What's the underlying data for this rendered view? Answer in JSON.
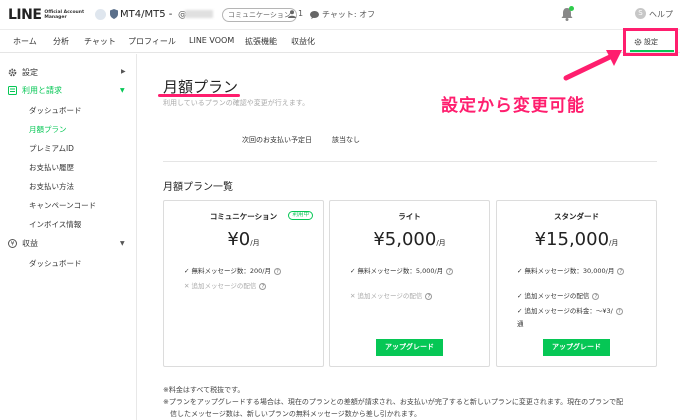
{
  "header": {
    "logo_main": "LINE",
    "logo_sub": "Official Account Manager",
    "account_name": "MT4/MT5 -",
    "account_id_prefix": "@",
    "plan_badge": "コミュニケーション",
    "friends": "1",
    "chat_status": "チャット: オフ",
    "help": "ヘルプ"
  },
  "nav": {
    "items": [
      "ホーム",
      "分析",
      "チャット",
      "プロフィール",
      "LINE VOOM",
      "拡張機能",
      "収益化"
    ],
    "settings": "設定"
  },
  "sidebar": {
    "settings": "設定",
    "billing": "利用と請求",
    "billing_items": [
      "ダッシュボード",
      "月額プラン",
      "プレミアムID",
      "お支払い履歴",
      "お支払い方法",
      "キャンペーンコード",
      "インボイス情報"
    ],
    "revenue": "収益",
    "revenue_items": [
      "ダッシュボード"
    ]
  },
  "main": {
    "title": "月額プラン",
    "description": "利用しているプランの確認や変更が行えます。",
    "callout": "設定から変更可能",
    "next_payment_label": "次回のお支払い予定日",
    "next_payment_value": "該当なし",
    "plans_title": "月額プラン一覧",
    "current_label": "利用中",
    "upgrade_label": "アップグレード",
    "notes": [
      "※料金はすべて税抜です。",
      "※プランをアップグレードする場合は、現在のプランとの差額が請求され、お支払いが完了すると新しいプランに変更されます。現在のプランで配",
      "　信したメッセージ数は、新しいプランの無料メッセージ数から差し引かれます。"
    ]
  },
  "plans": [
    {
      "name": "コミュニケーション",
      "price": "¥0",
      "unit": "/月",
      "current": true,
      "features": [
        {
          "text": "無料メッセージ数：200/月",
          "included": true
        },
        {
          "text": "追加メッセージの配信",
          "included": false
        }
      ]
    },
    {
      "name": "ライト",
      "price": "¥5,000",
      "unit": "/月",
      "current": false,
      "features": [
        {
          "text": "無料メッセージ数：5,000/月",
          "included": true
        },
        {
          "text": "追加メッセージの配信",
          "included": false
        }
      ]
    },
    {
      "name": "スタンダード",
      "price": "¥15,000",
      "unit": "/月",
      "current": false,
      "features": [
        {
          "text": "無料メッセージ数：30,000/月",
          "included": true
        },
        {
          "text": "追加メッセージの配信",
          "included": true
        },
        {
          "text": "追加メッセージの料金：～¥3/",
          "included": true
        },
        {
          "text": "通",
          "included": true
        }
      ]
    }
  ],
  "colors": {
    "accent_green": "#06c755",
    "highlight_pink": "#ff1e6e"
  }
}
